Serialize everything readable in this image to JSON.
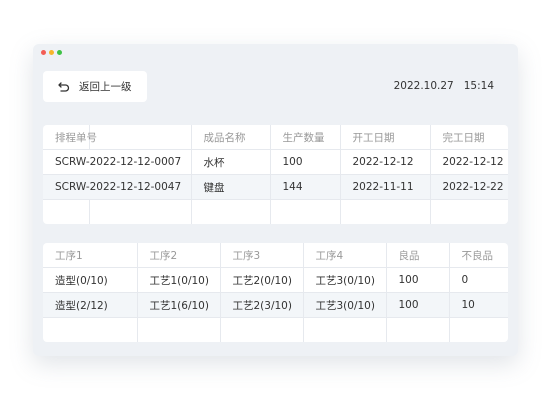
{
  "colors": {
    "dot_red": "#f35d55",
    "dot_yellow": "#f7b52c",
    "dot_green": "#3ec246"
  },
  "header": {
    "back_label": "返回上一级",
    "back_icon": "undo-arrow-icon",
    "date": "2022.10.27",
    "time": "15:14"
  },
  "order_table": {
    "columns": [
      "排程单号",
      "",
      "成品名称",
      "生产数量",
      "开工日期",
      "完工日期"
    ],
    "rows": [
      [
        "SCRW-2022-12-12-0007",
        "水杯",
        "100",
        "2022-12-12",
        "2022-12-12"
      ],
      [
        "SCRW-2022-12-12-0047",
        "键盘",
        "144",
        "2022-11-11",
        "2022-12-22"
      ]
    ]
  },
  "process_table": {
    "columns": [
      "工序1",
      "工序2",
      "工序3",
      "工序4",
      "良品",
      "不良品"
    ],
    "rows": [
      [
        "造型(0/10)",
        "工艺1(0/10)",
        "工艺2(0/10)",
        "工艺3(0/10)",
        "100",
        "0"
      ],
      [
        "造型(2/12)",
        "工艺1(6/10)",
        "工艺2(3/10)",
        "工艺3(0/10)",
        "100",
        "10"
      ]
    ]
  }
}
